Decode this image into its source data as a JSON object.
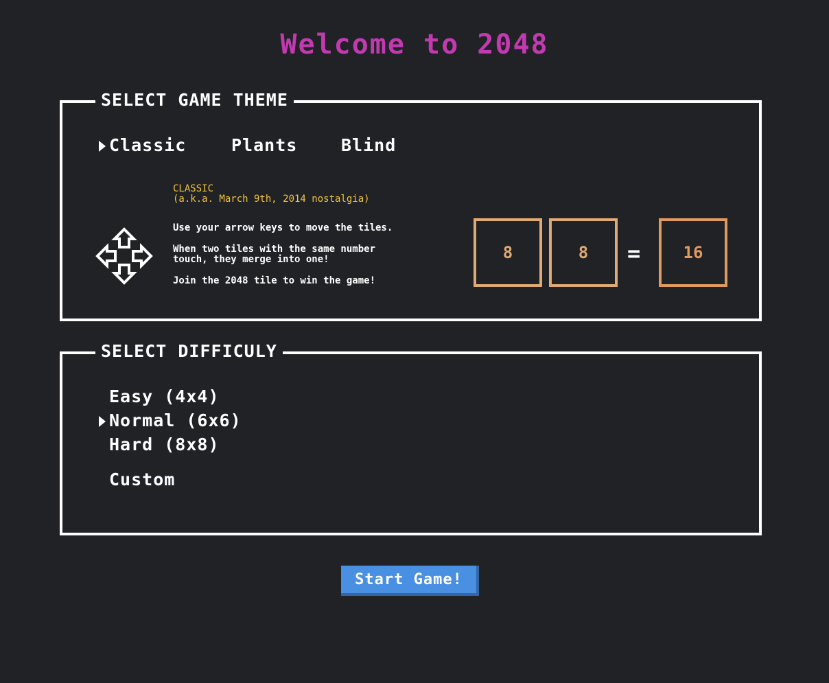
{
  "title": "Welcome to 2048",
  "theme_section": {
    "legend": "SELECT GAME THEME",
    "options": [
      "Classic",
      "Plants",
      "Blind"
    ],
    "selected": "Classic",
    "description": {
      "heading": "CLASSIC",
      "subheading": "(a.k.a. March 9th, 2014 nostalgia)",
      "line1": "Use your arrow keys to move the tiles.",
      "line2a": "When two tiles with the same number",
      "line2b": "touch, they merge into one!",
      "line3": "Join the 2048 tile to win the game!"
    },
    "example": {
      "tile_a": "8",
      "tile_b": "8",
      "equals": "=",
      "result": "16"
    },
    "icon": "arrow-keys-icon"
  },
  "difficulty_section": {
    "legend": "SELECT DIFFICULY",
    "options": [
      "Easy (4x4)",
      "Normal (6x6)",
      "Hard (8x8)",
      "Custom"
    ],
    "selected": "Normal (6x6)"
  },
  "start_button": "Start Game!",
  "colors": {
    "background": "#212226",
    "title": "#c23ab0",
    "accent_text": "#f2c53d",
    "tile_border": "#e0aa74",
    "tile_result": "#e0995e",
    "button": "#4a90e2"
  }
}
